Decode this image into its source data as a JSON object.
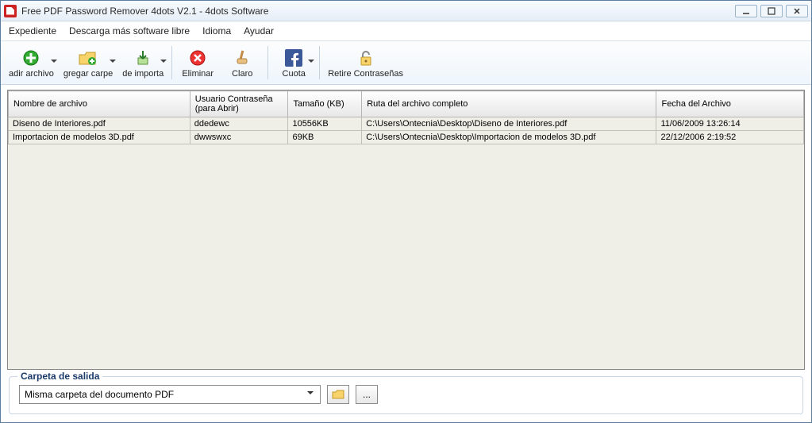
{
  "window": {
    "title": "Free PDF Password Remover 4dots V2.1 - 4dots Software"
  },
  "menu": [
    "Expediente",
    "Descarga más software libre",
    "Idioma",
    "Ayudar"
  ],
  "toolbar": {
    "add_file": "adir archivo",
    "add_folder": "gregar carpe",
    "import": "de importa",
    "delete": "Eliminar",
    "clear": "Claro",
    "share": "Cuota",
    "remove_pw": "Retire Contraseñas"
  },
  "columns": {
    "c0": "Nombre de archivo",
    "c1": "Usuario Contraseña (para Abrir)",
    "c2": "Tamaño (KB)",
    "c3": "Ruta del archivo completo",
    "c4": "Fecha del Archivo"
  },
  "rows": [
    {
      "file": "Diseno de Interiores.pdf",
      "pw": "ddedewc",
      "size": "10556KB",
      "path": "C:\\Users\\Ontecnia\\Desktop\\Diseno de Interiores.pdf",
      "date": "11/06/2009 13:26:14"
    },
    {
      "file": "Importacion de modelos 3D.pdf",
      "pw": "dwwswxc",
      "size": "69KB",
      "path": "C:\\Users\\Ontecnia\\Desktop\\Importacion de modelos 3D.pdf",
      "date": "22/12/2006 2:19:52"
    }
  ],
  "output": {
    "legend": "Carpeta de salida",
    "combo_value": "Misma carpeta del documento PDF",
    "browse_btn": "..."
  }
}
